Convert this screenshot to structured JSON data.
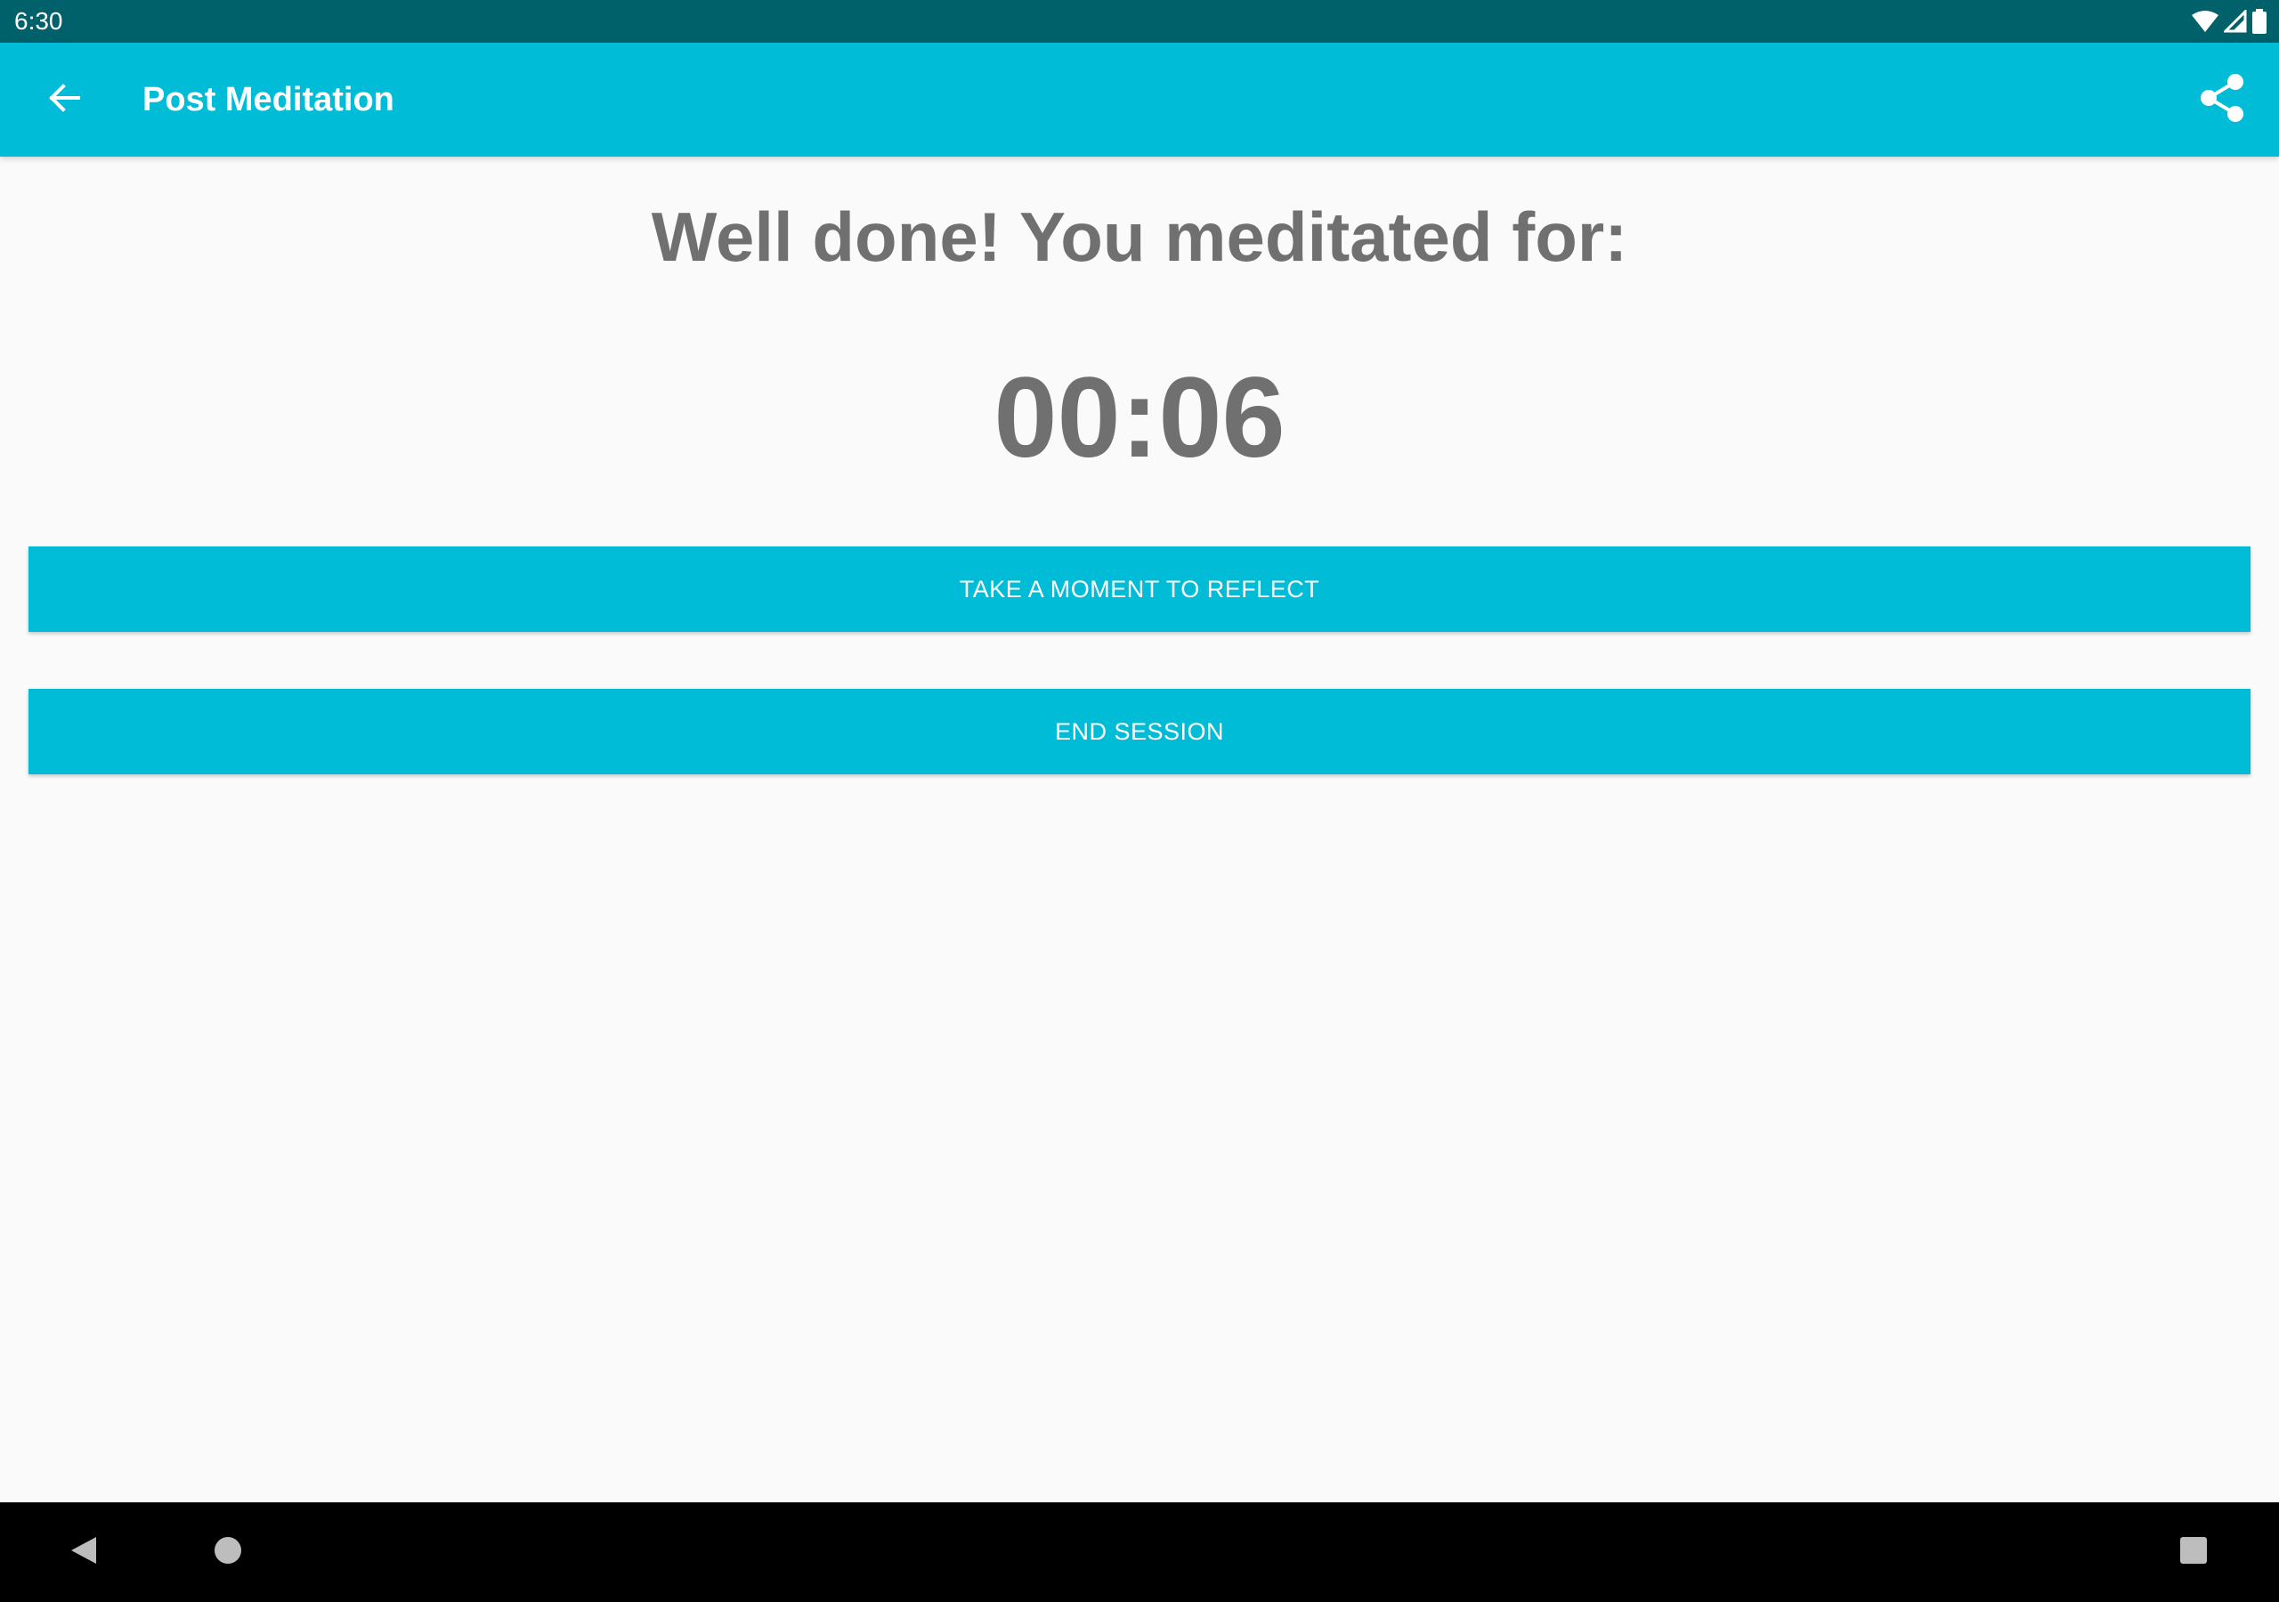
{
  "status_bar": {
    "time": "6:30"
  },
  "app_bar": {
    "title": "Post Meditation",
    "back_icon": "arrow-back-icon",
    "share_icon": "share-icon",
    "background_color": "#00BCD6"
  },
  "main": {
    "headline": "Well done! You meditated for:",
    "elapsed_time": "00:06",
    "buttons": [
      {
        "label": "TAKE A MOMENT TO REFLECT"
      },
      {
        "label": "END SESSION"
      }
    ]
  },
  "navigation_bar": {
    "items": [
      "nav-back-icon",
      "nav-home-icon",
      "nav-recents-icon"
    ]
  },
  "colors": {
    "accent": "#00BCD6",
    "status_bar": "#00616B",
    "text_gray": "#707070",
    "background": "#FAFAFA"
  }
}
